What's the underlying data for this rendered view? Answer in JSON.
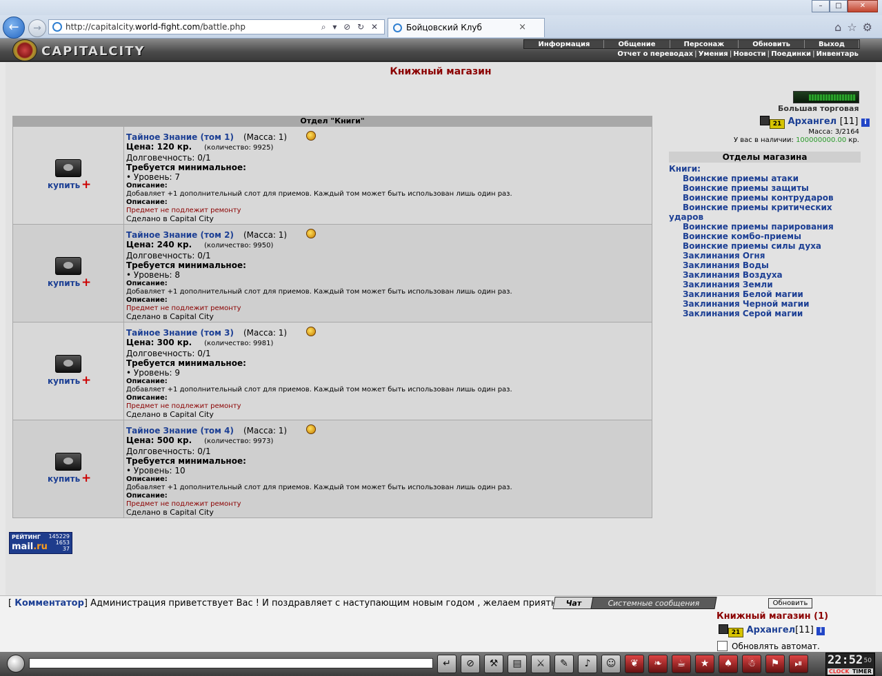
{
  "browser": {
    "url_prefix": "http://capitalcity.",
    "url_domain": "world-fight.com",
    "url_path": "/battle.php",
    "url_controls": "⌕ ▾ ⊘ ↻ ✕",
    "tab_title": "Бойцовский Клуб",
    "tab_close": "×",
    "nav_back": "←",
    "nav_fwd": "→",
    "win_min": "–",
    "win_max": "□",
    "win_close": "✕",
    "right_icons": "⌂☆⚙"
  },
  "site": {
    "logo_text": "CAPITALCITY",
    "menu": [
      "Информация",
      "Общение",
      "Персонаж",
      "Обновить",
      "Выход"
    ],
    "submenu": [
      "Отчет о переводах",
      "Умения",
      "Новости",
      "Поединки",
      "Инвентарь"
    ],
    "submenu_sep": "|"
  },
  "page": {
    "title": "Книжный магазин",
    "section_title": "Отдел \"Книги\""
  },
  "items": [
    {
      "name": "Тайное Знание (том 1)",
      "mass": "(Масса: 1)",
      "price": "Цена: 120 кр.",
      "qty": "(количество: 9925)",
      "durability": "Долговечность: 0/1",
      "req_title": "Требуется минимальное:",
      "level": "• Уровень: 7",
      "desc_label": "Описание:",
      "desc": "Добавляет +1 дополнительный слот для приемов. Каждый том может быть использован лишь один раз.",
      "desc_label2": "Описание:",
      "no_repair": "Предмет не подлежит ремонту",
      "made_in": "Сделано в Capital City",
      "buy": "купить",
      "plus": "+"
    },
    {
      "name": "Тайное Знание (том 2)",
      "mass": "(Масса: 1)",
      "price": "Цена: 240 кр.",
      "qty": "(количество: 9950)",
      "durability": "Долговечность: 0/1",
      "req_title": "Требуется минимальное:",
      "level": "• Уровень: 8",
      "desc_label": "Описание:",
      "desc": "Добавляет +1 дополнительный слот для приемов. Каждый том может быть использован лишь один раз.",
      "desc_label2": "Описание:",
      "no_repair": "Предмет не подлежит ремонту",
      "made_in": "Сделано в Capital City",
      "buy": "купить",
      "plus": "+"
    },
    {
      "name": "Тайное Знание (том 3)",
      "mass": "(Масса: 1)",
      "price": "Цена: 300 кр.",
      "qty": "(количество: 9981)",
      "durability": "Долговечность: 0/1",
      "req_title": "Требуется минимальное:",
      "level": "• Уровень: 9",
      "desc_label": "Описание:",
      "desc": "Добавляет +1 дополнительный слот для приемов. Каждый том может быть использован лишь один раз.",
      "desc_label2": "Описание:",
      "no_repair": "Предмет не подлежит ремонту",
      "made_in": "Сделано в Capital City",
      "buy": "купить",
      "plus": "+"
    },
    {
      "name": "Тайное Знание (том 4)",
      "mass": "(Масса: 1)",
      "price": "Цена: 500 кр.",
      "qty": "(количество: 9973)",
      "durability": "Долговечность: 0/1",
      "req_title": "Требуется минимальное:",
      "level": "• Уровень: 10",
      "desc_label": "Описание:",
      "desc": "Добавляет +1 дополнительный слот для приемов. Каждый том может быть использован лишь один раз.",
      "desc_label2": "Описание:",
      "no_repair": "Предмет не подлежит ремонту",
      "made_in": "Сделано в Capital City",
      "buy": "купить",
      "plus": "+"
    }
  ],
  "sidebar": {
    "big_trade": "Большая торговая",
    "player_name": "Архангел",
    "player_level": "[11]",
    "player_badge": "21",
    "info_i": "i",
    "mass": "Масса: 3/2164",
    "money_label": "У вас в наличии:",
    "money_value": "100000000.00",
    "money_unit": "кр.",
    "depts_title": "Отделы магазина",
    "books_label": "Книги:",
    "depts": [
      "Воинские приемы атаки",
      "Воинские приемы защиты",
      "Воинские приемы контрударов",
      "Воинские приемы критических ударов",
      "Воинские приемы парирования",
      "Воинские комбо-приемы",
      "Воинские приемы силы духа",
      "Заклинания Огня",
      "Заклинания Воды",
      "Заклинания Воздуха",
      "Заклинания Земли",
      "Заклинания Белой магии",
      "Заклинания Черной магии",
      "Заклинания Серой магии"
    ]
  },
  "rating": {
    "label": "РЕЙТИНГ",
    "brand_a": "mail",
    "brand_b": ".ru",
    "n1": "145229",
    "n2": "1653",
    "n3": "37"
  },
  "chat": {
    "open_bracket": "[",
    "who": "Комментатор",
    "close_bracket": "]",
    "message": "Администрация приветствует Вас ! И поздравляет с наступающим новым годом , желаем приятной игры",
    "tab_chat": "Чат",
    "tab_system": "Системные сообщения",
    "refresh": "Обновить",
    "room_title": "Книжный магазин (1)",
    "room_user": "Архангел",
    "room_user_level": "[11]",
    "auto_refresh": "Обновлять автомат."
  },
  "toolbar": {
    "icons": [
      "↵",
      "⊘",
      "⚒",
      "▤",
      "⚔",
      "✎",
      "♪",
      "☺"
    ],
    "red_icons": [
      "❦",
      "❧",
      "☕",
      "★",
      "♠",
      "☃",
      "⚑",
      "⏯"
    ],
    "time": "22:52",
    "sec": "50",
    "clock": "CLOCK",
    "timer": "TIMER"
  }
}
